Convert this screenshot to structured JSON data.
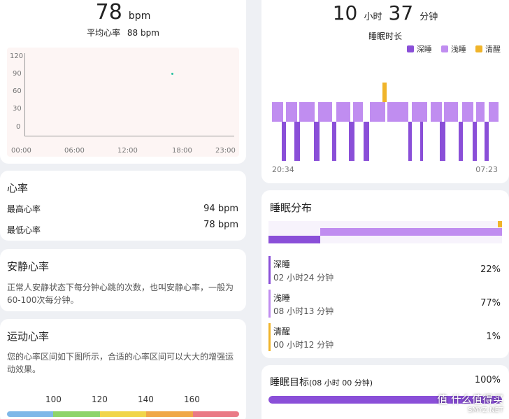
{
  "hr_summary": {
    "value": "78",
    "unit": "bpm",
    "avg_label": "平均心率",
    "avg_value": "88 bpm"
  },
  "hr_chart": {
    "y_ticks": [
      "120",
      "90",
      "60",
      "30",
      "0"
    ],
    "x_ticks": [
      "00:00",
      "06:00",
      "12:00",
      "18:00",
      "23:00"
    ],
    "point_color": "#29c0a0"
  },
  "hr_card": {
    "title": "心率",
    "max_label": "最高心率",
    "max_value": "94 bpm",
    "min_label": "最低心率",
    "min_value": "78 bpm"
  },
  "resting_card": {
    "title": "安静心率",
    "desc": "正常人安静状态下每分钟心跳的次数，也叫安静心率，一般为60-100次每分钟。"
  },
  "exercise_card": {
    "title": "运动心率",
    "desc": "您的心率区间如下图所示，合适的心率区间可以大大的增强运动效果。",
    "zones": [
      "100",
      "120",
      "140",
      "160"
    ],
    "zone_colors": [
      "#7fb8e8",
      "#8ed46a",
      "#f1d54a",
      "#f0a848",
      "#ea7a86"
    ]
  },
  "sleep_summary": {
    "hours": "10",
    "hours_unit": "小时",
    "minutes": "37",
    "minutes_unit": "分钟",
    "label": "睡眠时长",
    "legend": [
      {
        "label": "深睡",
        "color": "#8a4fd8"
      },
      {
        "label": "浅睡",
        "color": "#c08df0"
      },
      {
        "label": "清醒",
        "color": "#f0b42a"
      }
    ],
    "start_time": "20:34",
    "end_time": "07:23"
  },
  "sleep_dist": {
    "title": "睡眠分布",
    "items": [
      {
        "name": "深睡",
        "duration": "02 小时24 分钟",
        "percent": "22%",
        "color": "#8a4fd8"
      },
      {
        "name": "浅睡",
        "duration": "08 小时13 分钟",
        "percent": "77%",
        "color": "#c08df0"
      },
      {
        "name": "清醒",
        "duration": "00 小时12 分钟",
        "percent": "1%",
        "color": "#f0b42a"
      }
    ]
  },
  "sleep_goal": {
    "title": "睡眠目标",
    "subtitle": "(08 小时 00 分钟)",
    "percent": "100%",
    "progress": 1.0
  },
  "watermark": {
    "text": "值 什么值得买",
    "site": "SMYZ.NET"
  }
}
